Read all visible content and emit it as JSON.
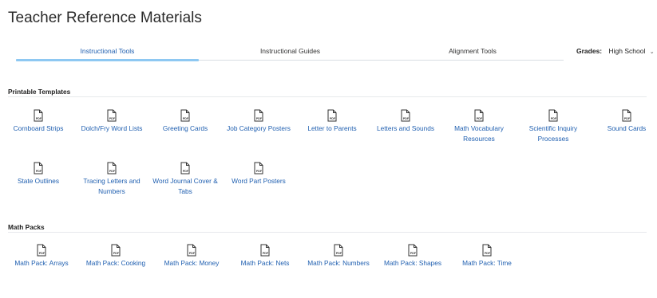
{
  "page": {
    "title": "Teacher Reference Materials"
  },
  "tabs": [
    {
      "label": "Instructional Tools",
      "active": true
    },
    {
      "label": "Instructional Guides",
      "active": false
    },
    {
      "label": "Alignment Tools",
      "active": false
    }
  ],
  "grades": {
    "label": "Grades:",
    "value": "High School",
    "icon": "chevron-down-icon"
  },
  "colors": {
    "link": "#1f5fb0",
    "active_tab_bar": "#8ec8f2",
    "divider": "#e7e9ec"
  },
  "icon_text": "PDF",
  "sections": [
    {
      "title": "Printable Templates",
      "items": [
        {
          "label": "Cornboard Strips"
        },
        {
          "label": "Dolch/Fry Word Lists"
        },
        {
          "label": "Greeting Cards"
        },
        {
          "label": "Job Category Posters"
        },
        {
          "label": "Letter to Parents"
        },
        {
          "label": "Letters and Sounds"
        },
        {
          "label": "Math Vocabulary Resources"
        },
        {
          "label": "Scientific Inquiry Processes"
        },
        {
          "label": "Sound Cards"
        },
        {
          "label": "State Outlines"
        },
        {
          "label": "Tracing Letters and Numbers"
        },
        {
          "label": "Word Journal Cover & Tabs"
        },
        {
          "label": "Word Part Posters"
        }
      ]
    },
    {
      "title": "Math Packs",
      "items": [
        {
          "label": "Math Pack: Arrays"
        },
        {
          "label": "Math Pack: Cooking"
        },
        {
          "label": "Math Pack: Money"
        },
        {
          "label": "Math Pack: Nets"
        },
        {
          "label": "Math Pack: Numbers"
        },
        {
          "label": "Math Pack: Shapes"
        },
        {
          "label": "Math Pack: Time"
        }
      ]
    }
  ]
}
